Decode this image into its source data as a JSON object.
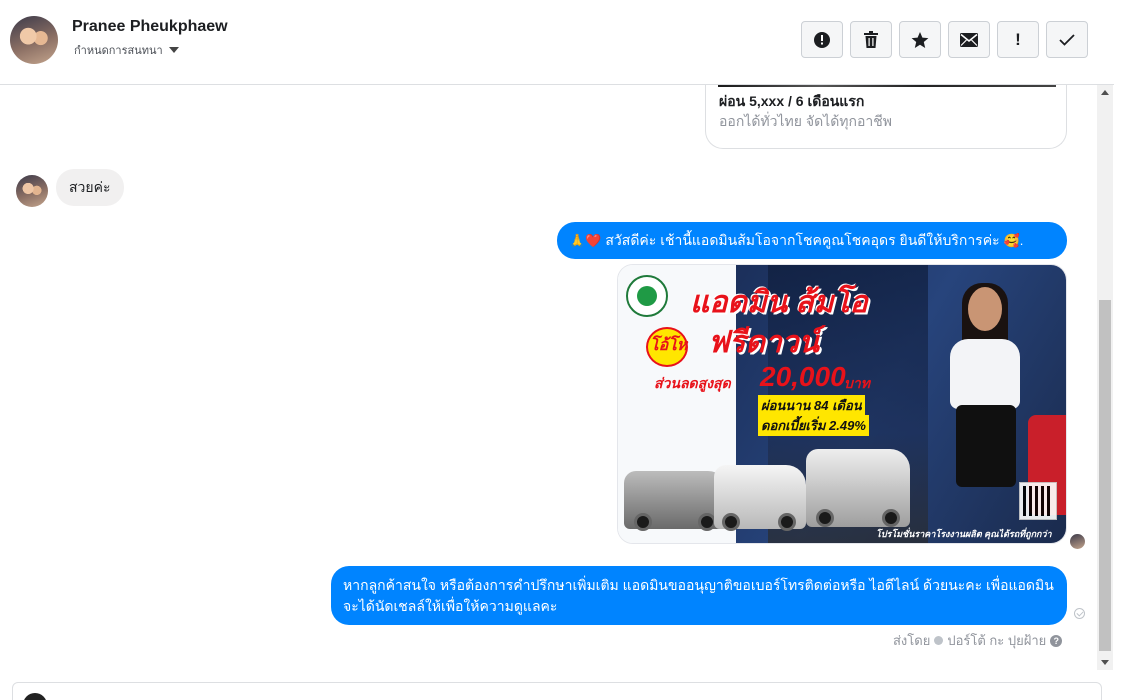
{
  "header": {
    "contact_name": "Pranee Pheukphaew",
    "conversation_setting": "กำหนดการสนทนา",
    "actions": [
      {
        "name": "report",
        "icon": "alert-circle-icon"
      },
      {
        "name": "delete",
        "icon": "trash-icon"
      },
      {
        "name": "star",
        "icon": "star-icon"
      },
      {
        "name": "mark-unread",
        "icon": "envelope-icon"
      },
      {
        "name": "follow-up",
        "icon": "exclamation-icon",
        "label": "!"
      },
      {
        "name": "done",
        "icon": "checkmark-icon"
      }
    ]
  },
  "messages": {
    "prev_card": {
      "title": "ผ่อน 5,xxx / 6 เดือนแรก",
      "subtitle": "ออกได้ทั่วไทย จัดได้ทุกอาชีพ"
    },
    "incoming_1": "สวยค่ะ",
    "outgoing_1": "สวัสดีค่ะ เช้านี้แอดมินส้มโอจากโชคคูณโชคอุดร ยินดีให้บริการค่ะ",
    "outgoing_1_emoji_prefix": "🙏❤️",
    "outgoing_1_emoji_suffix": "🥰.",
    "promo_image": {
      "title": "แอดมิน ส้มโอ",
      "badge": "โอ้โห",
      "headline": "ฟรีดาวน์",
      "discount_label": "ส่วนลดสูงสุด",
      "discount_amount": "20,000",
      "discount_unit": "บาท",
      "installment": "ผ่อนนาน 84 เดือน",
      "interest": "ดอกเบี้ยเริ่ม 2.49%",
      "footer": "โปรโมชั่นราคาโรงงานผลิต คุณได้รถที่ถูกกว่า"
    },
    "outgoing_2": "หากลูกค้าสนใจ หรือต้องการคำปรึกษาเพิ่มเติม แอดมินขออนุญาติขอเบอร์โทรติดต่อหรือ ไอดีไลน์ ด้วยนะคะ เพื่อแอดมินจะได้นัดเชลล์ให้เพื่อให้ความดูแลคะ",
    "sent_by_label": "ส่งโดย",
    "sent_by_name": "ปอร์โต้ กะ ปุยฝ้าย",
    "help_icon": "?"
  },
  "colors": {
    "outgoing_bubble": "#0084ff",
    "incoming_bubble": "#f1f0f0"
  }
}
